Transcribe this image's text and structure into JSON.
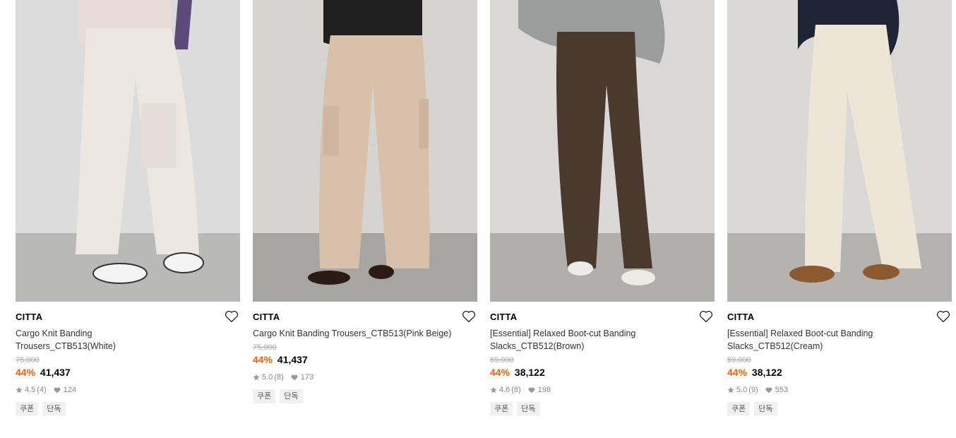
{
  "products": [
    {
      "brand": "CITTA",
      "name": "Cargo Knit Banding Trousers_CTB513(White)",
      "original_price": "75,000",
      "discount": "44%",
      "price": "41,437",
      "rating": "4.5",
      "review_count": "(4)",
      "likes": "124",
      "tags": [
        "쿠폰",
        "단독"
      ]
    },
    {
      "brand": "CITTA",
      "name": "Cargo Knit Banding Trousers_CTB513(Pink Beige)",
      "original_price": "75,000",
      "discount": "44%",
      "price": "41,437",
      "rating": "5.0",
      "review_count": "(8)",
      "likes": "173",
      "tags": [
        "쿠폰",
        "단독"
      ]
    },
    {
      "brand": "CITTA",
      "name": "[Essential] Relaxed Boot-cut Banding Slacks_CTB512(Brown)",
      "original_price": "69,000",
      "discount": "44%",
      "price": "38,122",
      "rating": "4.6",
      "review_count": "(8)",
      "likes": "198",
      "tags": [
        "쿠폰",
        "단독"
      ]
    },
    {
      "brand": "CITTA",
      "name": "[Essential] Relaxed Boot-cut Banding Slacks_CTB512(Cream)",
      "original_price": "69,000",
      "discount": "44%",
      "price": "38,122",
      "rating": "5.0",
      "review_count": "(9)",
      "likes": "553",
      "tags": [
        "쿠폰",
        "단독"
      ]
    }
  ],
  "colors": {
    "discount": "#f15f0c",
    "tag_bg": "#f1f1f1"
  },
  "icons": [
    "heart-outline-icon",
    "star-icon",
    "heart-filled-icon"
  ]
}
